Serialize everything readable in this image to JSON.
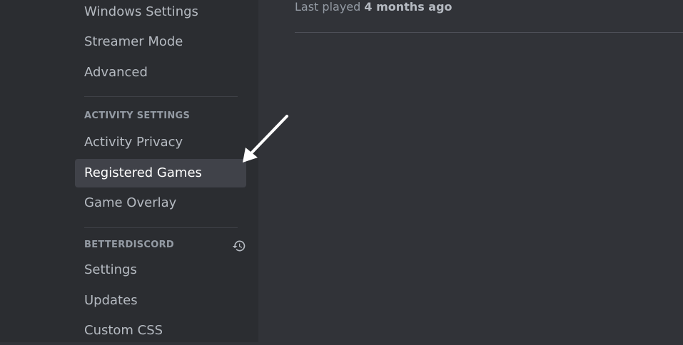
{
  "sidebar": {
    "items_top": [
      {
        "label": "Windows Settings"
      },
      {
        "label": "Streamer Mode"
      },
      {
        "label": "Advanced"
      }
    ],
    "activity_header": "ACTIVITY SETTINGS",
    "activity_items": [
      {
        "label": "Activity Privacy"
      },
      {
        "label": "Registered Games",
        "selected": true
      },
      {
        "label": "Game Overlay"
      }
    ],
    "betterdiscord_header": "BETTERDISCORD",
    "betterdiscord_items": [
      {
        "label": "Settings"
      },
      {
        "label": "Updates"
      },
      {
        "label": "Custom CSS"
      }
    ],
    "history_icon": "history-icon"
  },
  "content": {
    "last_played_prefix": "Last played",
    "last_played_value": "4 months ago"
  },
  "annotation": {
    "arrow_color": "#ffffff"
  },
  "colors": {
    "sidebar_bg": "#2b2d31",
    "content_bg": "#313338",
    "selected_bg": "#404249",
    "text_muted": "#b5bac1",
    "header_text": "#949ba4"
  }
}
